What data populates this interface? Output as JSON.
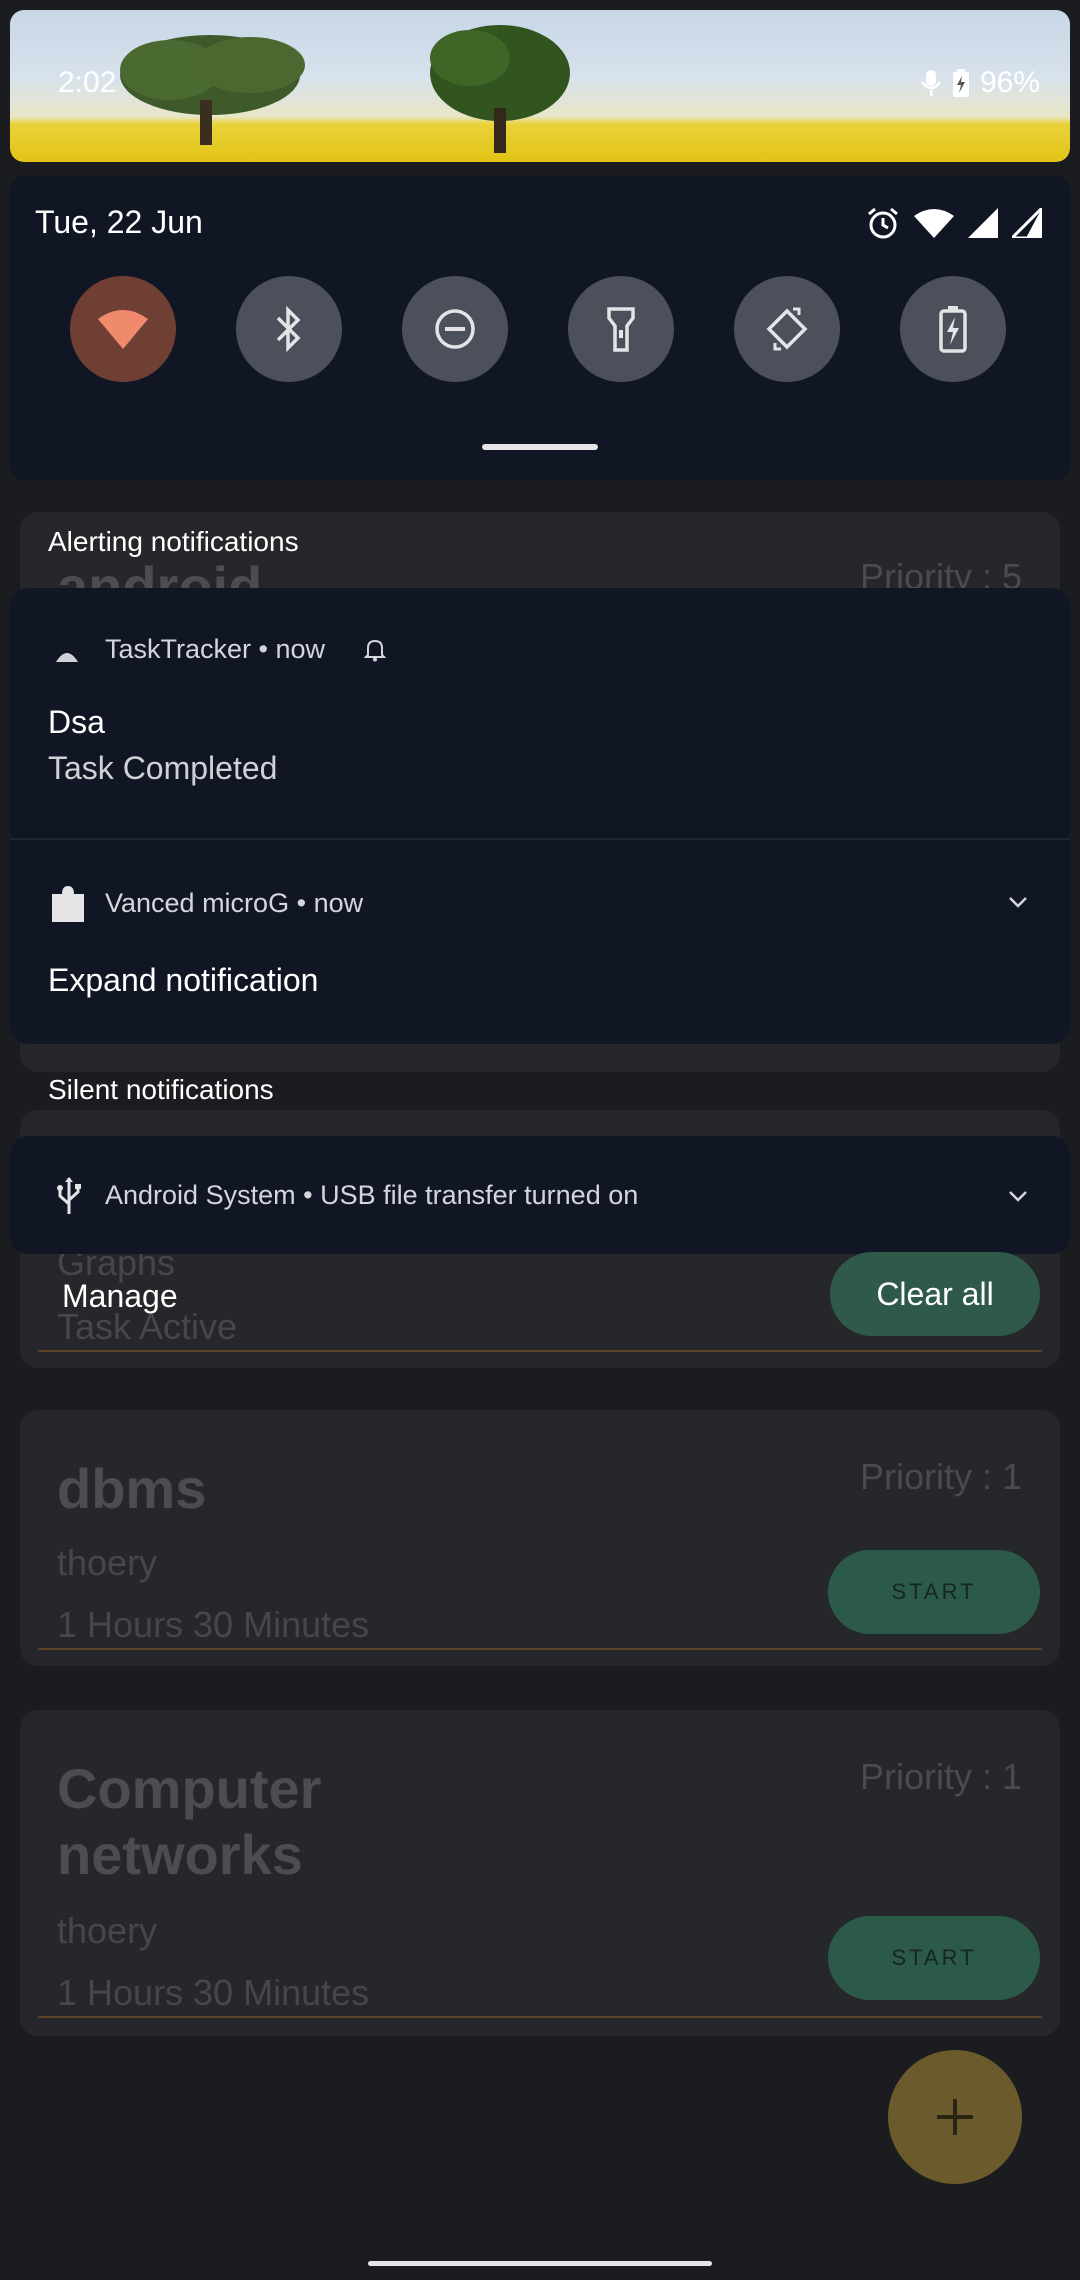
{
  "status_bar": {
    "time": "2:02",
    "battery": "96%"
  },
  "quick_settings": {
    "date": "Tue, 22 Jun",
    "tiles": [
      {
        "icon": "wifi-icon",
        "active": true
      },
      {
        "icon": "bluetooth-icon",
        "active": false
      },
      {
        "icon": "do-not-disturb-icon",
        "active": false
      },
      {
        "icon": "flashlight-icon",
        "active": false
      },
      {
        "icon": "auto-rotate-icon",
        "active": false
      },
      {
        "icon": "battery-saver-icon",
        "active": false
      }
    ]
  },
  "alerting": {
    "header": "Alerting notifications",
    "notifications": [
      {
        "app": "TaskTracker",
        "time": "now",
        "title": "Dsa",
        "text": "Task Completed"
      },
      {
        "app": "Vanced microG",
        "time": "now",
        "text": "Expand notification"
      }
    ]
  },
  "silent": {
    "header": "Silent notifications",
    "notifications": [
      {
        "app": "Android System",
        "text": "USB file transfer turned on"
      }
    ]
  },
  "actions": {
    "manage": "Manage",
    "clear_all": "Clear all"
  },
  "app": {
    "cards": [
      {
        "title": "android",
        "priority": "Priority : 5"
      },
      {
        "title": "Graphs",
        "status": "Task Active"
      },
      {
        "title": "dbms",
        "priority": "Priority : 1",
        "desc": "thoery",
        "time": "1 Hours 30 Minutes",
        "button": "START"
      },
      {
        "title": "Computer networks",
        "priority": "Priority : 1",
        "desc": "thoery",
        "time": "1 Hours 30 Minutes",
        "button": "START"
      }
    ]
  },
  "colors": {
    "panel": "#111625",
    "active_tile": "#703f34",
    "accent_green": "#2f5a49"
  }
}
